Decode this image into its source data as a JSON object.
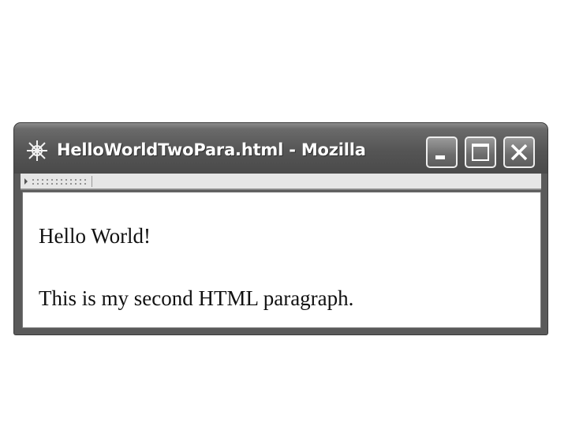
{
  "window": {
    "title": "HelloWorldTwoPara.html - Mozilla",
    "app_icon": "mozilla-app-icon",
    "controls": {
      "minimize": "minimize-icon",
      "maximize": "maximize-icon",
      "close": "close-icon"
    }
  },
  "toolbar": {
    "grip_icon": "toolbar-grip-icon"
  },
  "content": {
    "paragraphs": [
      "Hello World!",
      "This is my second HTML paragraph."
    ]
  }
}
